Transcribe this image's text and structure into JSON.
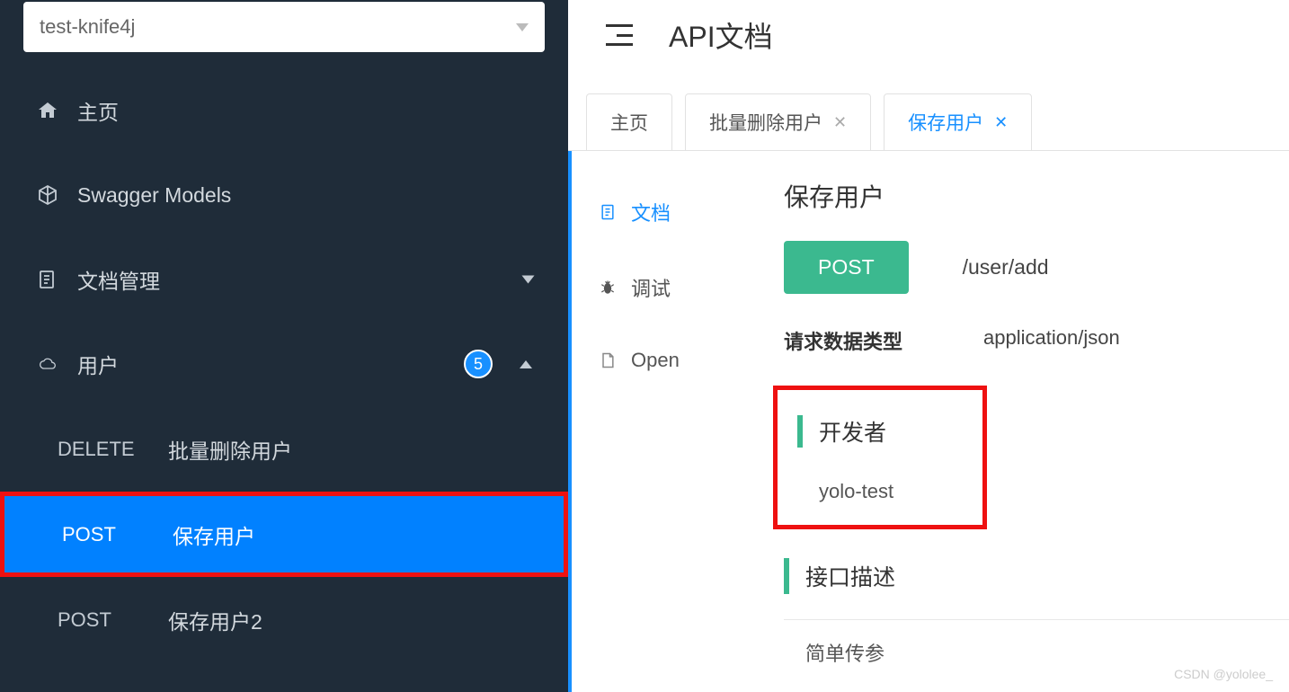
{
  "sidebar": {
    "select_value": "test-knife4j",
    "nav": {
      "home": "主页",
      "swagger": "Swagger Models",
      "doc_manage": "文档管理",
      "user_group": "用户",
      "user_badge": "5"
    },
    "endpoints": [
      {
        "method": "DELETE",
        "label": "批量删除用户"
      },
      {
        "method": "POST",
        "label": "保存用户"
      },
      {
        "method": "POST",
        "label": "保存用户2"
      }
    ]
  },
  "header": {
    "page_title": "API文档"
  },
  "tabs": [
    {
      "label": "主页",
      "closable": false
    },
    {
      "label": "批量删除用户",
      "closable": true
    },
    {
      "label": "保存用户",
      "closable": true,
      "active": true
    }
  ],
  "doc_tabs": {
    "doc": "文档",
    "debug": "调试",
    "open": "Open"
  },
  "detail": {
    "name": "保存用户",
    "method": "POST",
    "path": "/user/add",
    "req_type_label": "请求数据类型",
    "req_type_value": "application/json",
    "developer_label": "开发者",
    "developer_value": "yolo-test",
    "desc_label": "接口描述",
    "desc_value": "简单传参"
  },
  "watermark": "CSDN @yololee_"
}
